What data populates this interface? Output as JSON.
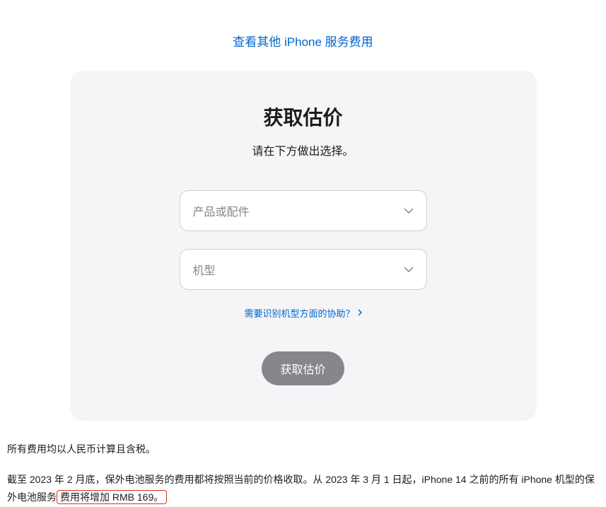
{
  "topLink": {
    "text": "查看其他 iPhone 服务费用"
  },
  "card": {
    "title": "获取估价",
    "subtitle": "请在下方做出选择。",
    "select1": {
      "placeholder": "产品或配件"
    },
    "select2": {
      "placeholder": "机型"
    },
    "helpLink": {
      "text": "需要识别机型方面的协助？"
    },
    "submitButton": {
      "label": "获取估价"
    }
  },
  "footer": {
    "line1": "所有费用均以人民币计算且含税。",
    "line2_part1": "截至 2023 年 2 月底，保外电池服务的费用都将按照当前的价格收取。从 2023 年 3 月 1 日起，iPhone 14 之前的所有 iPhone 机型的保外电池服务",
    "line2_highlight": "费用将增加 RMB 169。"
  }
}
